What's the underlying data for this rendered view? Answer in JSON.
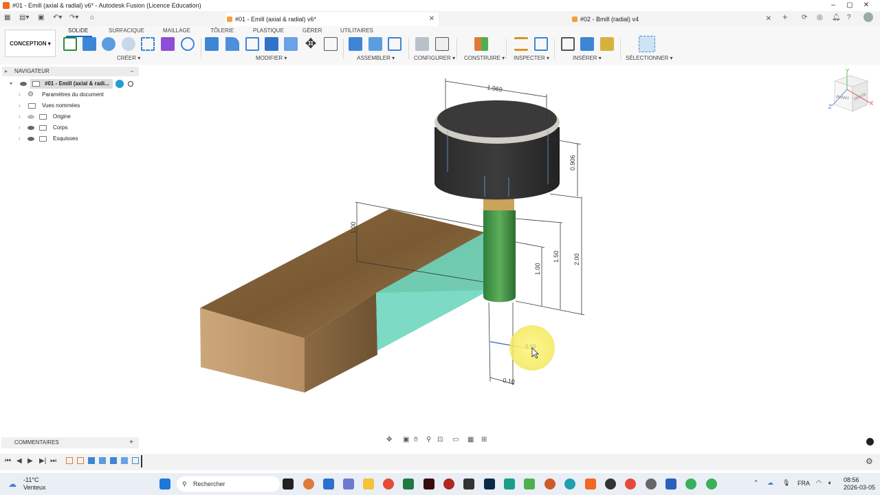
{
  "window": {
    "title": "#01 - Emill (axial & radial) v6* - Autodesk Fusion (Licence Education)"
  },
  "doc_tabs": [
    {
      "label": "#01 - Emill (axial & radial) v6*"
    },
    {
      "label": "#02 - Bmill (radial) v4"
    }
  ],
  "ribbon": {
    "workspace": "CONCEPTION",
    "tabs": [
      "SOLIDE",
      "SURFACIQUE",
      "MAILLAGE",
      "TÔLERIE",
      "PLASTIQUE",
      "GÉRER",
      "UTILITAIRES"
    ],
    "groups": {
      "create": "CRÉER ▾",
      "modify": "MODIFIER ▾",
      "assemble": "ASSEMBLER ▾",
      "configure": "CONFIGURER ▾",
      "construct": "CONSTRUIRE ▾",
      "inspect": "INSPECTER ▾",
      "insert": "INSÉRER ▾",
      "select": "SÉLECTIONNER ▾"
    }
  },
  "navigator": {
    "title": "NAVIGATEUR",
    "root": "#01 - Emill (axial & radi...",
    "items": [
      "Paramètres du document",
      "Vues nommées",
      "Origine",
      "Corps",
      "Esquisses"
    ]
  },
  "viewcube": {
    "front": "AVANT",
    "right": "DROITE",
    "x": "X",
    "y": "Y",
    "z": "Z"
  },
  "dimensions": {
    "d1": "1.969",
    "d2": "0.906",
    "d3": "1.50",
    "d4": "2.00",
    "d5": "1.00",
    "d6": "1.00",
    "d7": "0.50",
    "d8": "0.10"
  },
  "comments": {
    "label": "COMMENTAIRES"
  },
  "taskbar": {
    "weather_temp": "-11°C",
    "weather_desc": "Venteux",
    "search_placeholder": "Rechercher",
    "lang": "FRA",
    "time": "08:56",
    "date": "2026-03-05"
  }
}
